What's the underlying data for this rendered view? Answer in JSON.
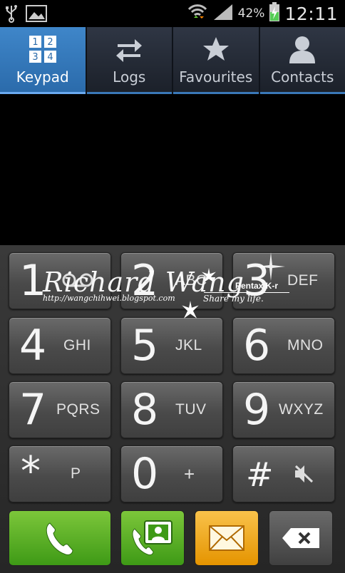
{
  "status": {
    "battery_pct": "42%",
    "time": "12:11"
  },
  "tabs": [
    {
      "label": "Keypad",
      "icon": "keypad-icon",
      "active": true
    },
    {
      "label": "Logs",
      "icon": "swap-arrows-icon",
      "active": false
    },
    {
      "label": "Favourites",
      "icon": "star-icon",
      "active": false
    },
    {
      "label": "Contacts",
      "icon": "person-icon",
      "active": false
    }
  ],
  "keypad_icon_digits": [
    "1",
    "2",
    "3",
    "4"
  ],
  "keys": [
    {
      "digit": "1",
      "letters": ""
    },
    {
      "digit": "2",
      "letters": "ABC"
    },
    {
      "digit": "3",
      "letters": "DEF"
    },
    {
      "digit": "4",
      "letters": "GHI"
    },
    {
      "digit": "5",
      "letters": "JKL"
    },
    {
      "digit": "6",
      "letters": "MNO"
    },
    {
      "digit": "7",
      "letters": "PQRS"
    },
    {
      "digit": "8",
      "letters": "TUV"
    },
    {
      "digit": "9",
      "letters": "WXYZ"
    },
    {
      "digit": "*",
      "letters": "P"
    },
    {
      "digit": "0",
      "letters": "+"
    },
    {
      "digit": "#",
      "letters": ""
    }
  ],
  "watermark": {
    "name": "Richard Wang",
    "url": "http://wangchihwei.blogspot.com",
    "camera": "Pentax K-r",
    "tagline": "Share my life."
  },
  "colors": {
    "accent_blue": "#2a6aaa",
    "call_green": "#3e9a16",
    "message_orange": "#e59400"
  }
}
